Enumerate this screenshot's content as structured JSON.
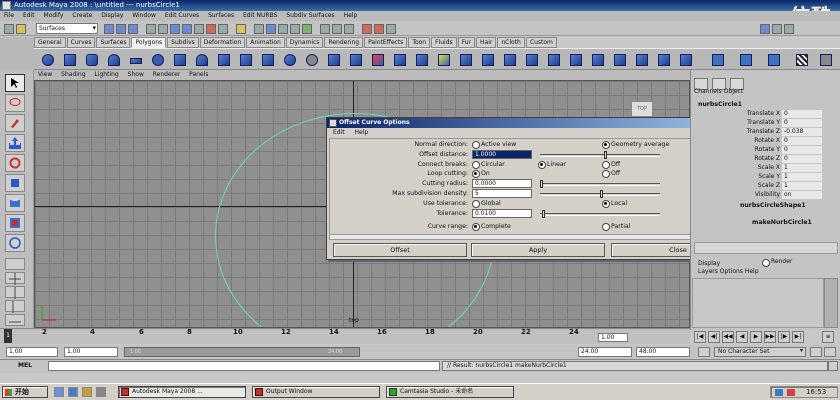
{
  "window": {
    "title": "Autodesk Maya 2008 : \\untitled  ---  nurbsCircle1"
  },
  "watermark": "仿酷",
  "menubar": [
    "File",
    "Edit",
    "Modify",
    "Create",
    "Display",
    "Window",
    "Edit Curves",
    "Surfaces",
    "Edit NURBS",
    "Subdiv Surfaces",
    "Help"
  ],
  "status": {
    "mode": "Surfaces"
  },
  "shelf": {
    "tabs": [
      "General",
      "Curves",
      "Surfaces",
      "Polygons",
      "Subdivs",
      "Deformation",
      "Animation",
      "Dynamics",
      "Rendering",
      "PaintEffects",
      "Toon",
      "Fluids",
      "Fur",
      "Hair",
      "nCloth",
      "Custom"
    ],
    "active": "Polygons"
  },
  "panelmenu": [
    "View",
    "Shading",
    "Lighting",
    "Show",
    "Renderer",
    "Panels"
  ],
  "viewport": {
    "cube_label": "TOP",
    "camera": "top"
  },
  "dialog": {
    "title": "Offset Curve Options",
    "menu": [
      "Edit",
      "Help"
    ],
    "labels": {
      "normal": "Normal direction:",
      "distance": "Offset distance:",
      "breaks": "Connect breaks:",
      "loop": "Loop cutting:",
      "radius": "Cutting radius:",
      "density": "Max subdivision density:",
      "usetol": "Use tolerance:",
      "tol": "Tolerance:",
      "range": "Curve range:"
    },
    "options": {
      "active_view": "Active view",
      "geometry_average": "Geometry average",
      "circular": "Circular",
      "linear": "Linear",
      "off": "Off",
      "on": "On",
      "global": "Global",
      "local": "Local",
      "complete": "Complete",
      "partial": "Partial"
    },
    "values": {
      "distance": "1.0000",
      "radius": "0.0000",
      "density": "5",
      "tol": "0.0100"
    },
    "buttons": {
      "offset": "Offset",
      "apply": "Apply",
      "close": "Close"
    }
  },
  "channelbox": {
    "tabs": "Channels  Object",
    "object": "nurbsCircle1",
    "rows": [
      {
        "name": "Translate X",
        "value": "0"
      },
      {
        "name": "Translate Y",
        "value": "0"
      },
      {
        "name": "Translate Z",
        "value": "-0.038"
      },
      {
        "name": "Rotate X",
        "value": "0"
      },
      {
        "name": "Rotate Y",
        "value": "0"
      },
      {
        "name": "Rotate Z",
        "value": "0"
      },
      {
        "name": "Scale X",
        "value": "1"
      },
      {
        "name": "Scale Y",
        "value": "1"
      },
      {
        "name": "Scale Z",
        "value": "1"
      },
      {
        "name": "Visibility",
        "value": "on"
      }
    ],
    "shape": "nurbsCircleShape1",
    "inputs": "makeNurbCircle1",
    "layer_display": "Display",
    "layer_render": "Render",
    "layer_menu": "Layers  Options  Help"
  },
  "timeline": {
    "ticks": [
      "2",
      "4",
      "6",
      "8",
      "10",
      "12",
      "14",
      "16",
      "18",
      "20",
      "22",
      "24"
    ],
    "current_frame": "1",
    "current_field": "1.00"
  },
  "range": {
    "start": "1.00",
    "playback_start": "1.00",
    "track_start": "1.00",
    "track_end": "24.00",
    "playback_end": "24.00",
    "end": "48.00",
    "character_set": "No Character Set"
  },
  "command": {
    "label": "MEL",
    "result": "// Result: nurbsCircle1 makeNurbCircle1"
  },
  "taskbar": {
    "start": "开始",
    "tasks": [
      "Autodesk Maya 2008 ...",
      "Output Window",
      "Camtasia Studio - 未命名"
    ],
    "clock": "16:53"
  }
}
